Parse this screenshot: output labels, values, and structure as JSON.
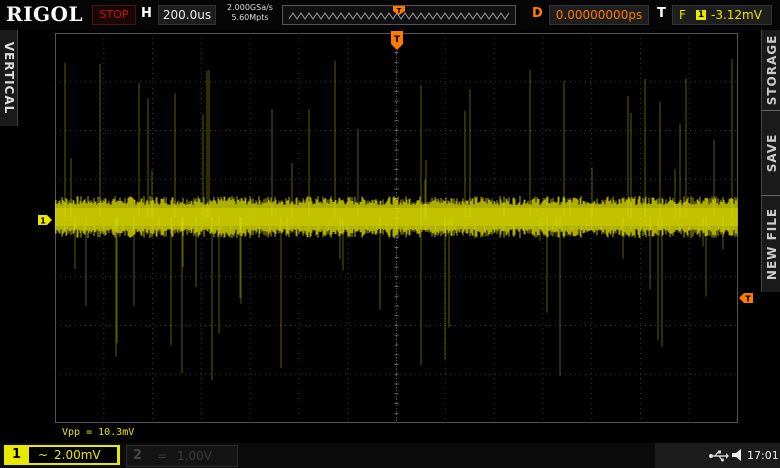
{
  "brand": "RIGOL",
  "run_state": "STOP",
  "timebase": {
    "label": "H",
    "value": "200.0us"
  },
  "acquisition": {
    "sample_rate": "2.000GSa/s",
    "memory_depth": "5.60Mpts"
  },
  "trigger_position_marker": "T",
  "delay": {
    "label": "D",
    "value": "0.00000000ps"
  },
  "trigger": {
    "label": "T",
    "edge_icon": "rising-edge-icon",
    "source": "1",
    "level": "-3.12mV"
  },
  "left_tab": "VERTICAL",
  "right_tabs": [
    "STORAGE",
    "SAVE",
    "NEW FILE"
  ],
  "channel1_marker": "1",
  "measurement": "Vpp = 10.3mV",
  "channels": [
    {
      "number": "1",
      "coupling": "~",
      "scale": "2.00mV",
      "active": true
    },
    {
      "number": "2",
      "coupling": "=",
      "scale": "1.00V",
      "active": false
    }
  ],
  "status": {
    "clock": "17:01",
    "icons": [
      "usb-icon",
      "speaker-icon"
    ]
  },
  "colors": {
    "ch1": "#e8e800",
    "trigger": "#ff7b00",
    "stop": "#c01818",
    "grid": "#3a3a3a"
  }
}
